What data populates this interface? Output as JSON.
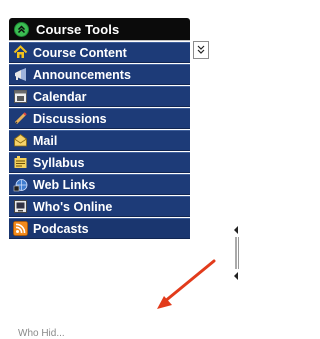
{
  "panel": {
    "title": "Course Tools",
    "items": [
      {
        "label": "Course Content",
        "icon": "house-icon"
      },
      {
        "label": "Announcements",
        "icon": "megaphone-icon"
      },
      {
        "label": "Calendar",
        "icon": "calendar-icon"
      },
      {
        "label": "Discussions",
        "icon": "pencil-icon"
      },
      {
        "label": "Mail",
        "icon": "mail-icon"
      },
      {
        "label": "Syllabus",
        "icon": "syllabus-icon"
      },
      {
        "label": "Web Links",
        "icon": "globe-link-icon"
      },
      {
        "label": "Who's Online",
        "icon": "monitor-user-icon"
      },
      {
        "label": "Podcasts",
        "icon": "rss-icon"
      }
    ]
  },
  "footer_text": "Who Hid...",
  "colors": {
    "header_bg": "#0b0b0b",
    "item_bg": "#1d3b78",
    "arrow": "#e23b1b"
  }
}
